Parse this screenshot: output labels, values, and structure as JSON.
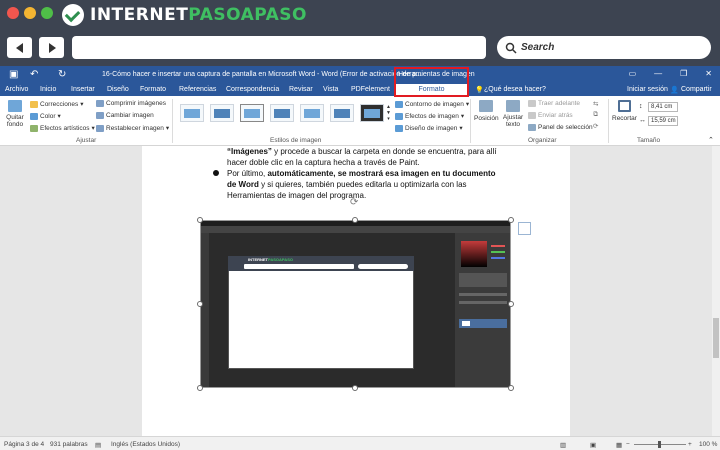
{
  "browser": {
    "logo_part1": "INTERNET",
    "logo_part2": "PASOAPASO",
    "search_label": "Search",
    "colors": {
      "chrome": "#3d4451",
      "close": "#f1564e",
      "minimize": "#f4b532",
      "maximize": "#4fbe48",
      "logo_accent": "#3fbf62"
    },
    "icons": [
      "arrow-left-icon",
      "arrow-right-icon",
      "search-icon",
      "logo-check-icon"
    ]
  },
  "word": {
    "title": "16-Cómo hacer e insertar una captura de pantalla en Microsoft Word - Word (Error de activación de p...",
    "context_group": "Herramientas de imagen",
    "tabs": [
      "Archivo",
      "Inicio",
      "Insertar",
      "Diseño",
      "Formato",
      "Referencias",
      "Correspondencia",
      "Revisar",
      "Vista",
      "PDFelement"
    ],
    "active_context_tab": "Formato",
    "tell_me": "¿Qué desea hacer?",
    "sign_in": "Iniciar sesión",
    "share": "Compartir",
    "colors": {
      "accent": "#2b579a",
      "highlight_box": "#e11b22"
    }
  },
  "ribbon": {
    "quitar_fondo": "Quitar fondo",
    "correcciones": "Correcciones",
    "color": "Color",
    "efectos_artisticos": "Efectos artísticos",
    "comprimir": "Comprimir imágenes",
    "cambiar": "Cambiar imagen",
    "restablecer": "Restablecer imagen",
    "group_ajustar": "Ajustar",
    "group_estilos": "Estilos de imagen",
    "contorno": "Contorno de imagen",
    "efectos": "Efectos de imagen",
    "diseno": "Diseño de imagen",
    "posicion": "Posición",
    "ajustar_texto": "Ajustar texto",
    "traer": "Traer adelante",
    "enviar": "Enviar atrás",
    "panel": "Panel de selección",
    "group_organizar": "Organizar",
    "recortar": "Recortar",
    "height": "8,41 cm",
    "width": "15,59 cm",
    "group_tamano": "Tamaño"
  },
  "document": {
    "line1_bold": "“Imágenes”",
    "line1_rest": " y procede a buscar la carpeta en donde se encuentra, para allí",
    "line2": "hacer doble clic en la captura hecha a través de Paint.",
    "b_line1_a": "Por último, ",
    "b_line1_bold": "automáticamente, se mostrará esa imagen en tu documento",
    "b_line2_bold": "de Word",
    "b_line2_rest": " y si quieres, también puedes editarla u optimizarla con las",
    "b_line3": "Herramientas de imagen del programa."
  },
  "status": {
    "page": "Página 3 de 4",
    "words": "931 palabras",
    "language": "Inglés (Estados Unidos)",
    "zoom": "100 %"
  }
}
